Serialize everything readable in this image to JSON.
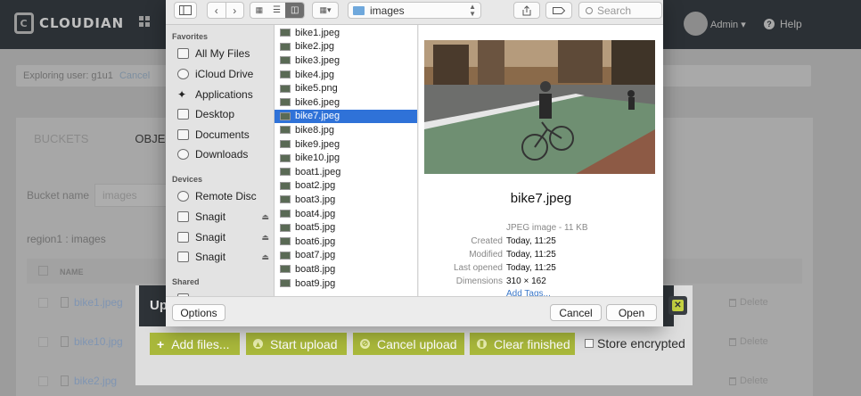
{
  "app": {
    "brand": "CLOUDIAN",
    "admin_label": "Admin ▾",
    "help_label": "Help",
    "user_bar": {
      "text": "Exploring user: g1u1",
      "cancel": "Cancel"
    },
    "tabs": [
      "BUCKETS",
      "OBJECTS"
    ],
    "bucket_label": "Bucket name",
    "bucket_value": "images",
    "region_path": "region1 : images",
    "table_header": "NAME",
    "rows": [
      {
        "name": "bike1.jpeg",
        "action": "Delete"
      },
      {
        "name": "bike10.jpg",
        "action": "Delete"
      },
      {
        "name": "bike2.jpg",
        "action": "Delete"
      }
    ]
  },
  "upload": {
    "title": "Up",
    "buttons": [
      "Add files...",
      "Start upload",
      "Cancel upload",
      "Clear finished"
    ],
    "store_encrypted": "Store encrypted"
  },
  "dialog": {
    "location": "images",
    "search_placeholder": "Search",
    "sidebar": {
      "favorites_header": "Favorites",
      "favorites": [
        "All My Files",
        "iCloud Drive",
        "Applications",
        "Desktop",
        "Documents",
        "Downloads"
      ],
      "devices_header": "Devices",
      "devices": [
        "Remote Disc",
        "Snagit",
        "Snagit",
        "Snagit"
      ],
      "shared_header": "Shared"
    },
    "files": [
      "bike1.jpeg",
      "bike2.jpg",
      "bike3.jpeg",
      "bike4.jpg",
      "bike5.png",
      "bike6.jpeg",
      "bike7.jpeg",
      "bike8.jpg",
      "bike9.jpeg",
      "bike10.jpg",
      "boat1.jpeg",
      "boat2.jpg",
      "boat3.jpg",
      "boat4.jpg",
      "boat5.jpg",
      "boat6.jpg",
      "boat7.jpg",
      "boat8.jpg",
      "boat9.jpg"
    ],
    "selected_file": "bike7.jpeg",
    "preview": {
      "name": "bike7.jpeg",
      "kind": "JPEG image - 11 KB",
      "meta": [
        {
          "key": "Created",
          "value": "Today, 11:25"
        },
        {
          "key": "Modified",
          "value": "Today, 11:25"
        },
        {
          "key": "Last opened",
          "value": "Today, 11:25"
        },
        {
          "key": "Dimensions",
          "value": "310 × 162"
        }
      ],
      "add_tags": "Add Tags..."
    },
    "options_button": "Options",
    "cancel_button": "Cancel",
    "open_button": "Open"
  },
  "colors": {
    "selection": "#2f72d8",
    "upload_button": "#a9b83b",
    "close_accent": "#c6d342",
    "link": "#3b78c9"
  }
}
